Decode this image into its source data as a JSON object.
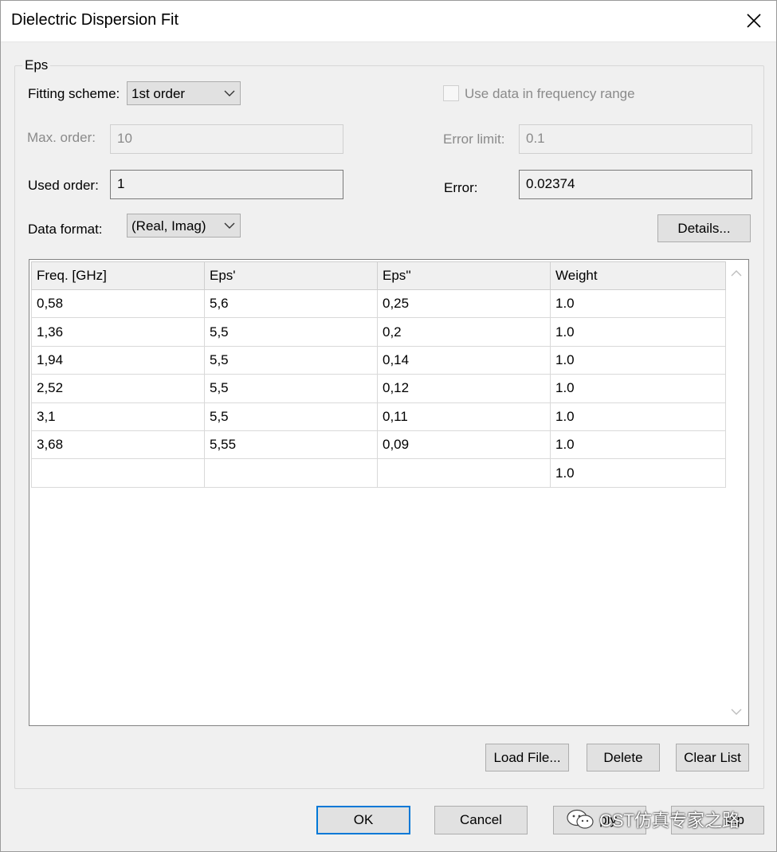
{
  "window": {
    "title": "Dielectric Dispersion Fit"
  },
  "group": {
    "label": "Eps"
  },
  "fitting_scheme": {
    "label": "Fitting scheme:",
    "value": "1st order"
  },
  "use_range": {
    "label": "Use data in frequency range",
    "checked": false
  },
  "max_order": {
    "label": "Max. order:",
    "value": "10"
  },
  "error_limit": {
    "label": "Error limit:",
    "value": "0.1"
  },
  "used_order": {
    "label": "Used order:",
    "value": "1"
  },
  "error": {
    "label": "Error:",
    "value": "0.02374"
  },
  "data_format": {
    "label": "Data format:",
    "value": "(Real, Imag)"
  },
  "buttons": {
    "details": "Details...",
    "load_file": "Load File...",
    "delete": "Delete",
    "clear_list": "Clear List",
    "ok": "OK",
    "cancel": "Cancel",
    "apply_partial": "ply",
    "help_partial": "elp"
  },
  "table": {
    "columns": [
      "Freq. [GHz]",
      "Eps'",
      "Eps''",
      "Weight"
    ],
    "rows": [
      [
        "0,58",
        "5,6",
        "0,25",
        "1.0"
      ],
      [
        "1,36",
        "5,5",
        "0,2",
        "1.0"
      ],
      [
        "1,94",
        "5,5",
        "0,14",
        "1.0"
      ],
      [
        "2,52",
        "5,5",
        "0,12",
        "1.0"
      ],
      [
        "3,1",
        "5,5",
        "0,11",
        "1.0"
      ],
      [
        "3,68",
        "5,55",
        "0,09",
        "1.0"
      ],
      [
        "",
        "",
        "",
        "1.0"
      ]
    ]
  },
  "watermark": {
    "text": "CST仿真专家之路",
    "icon": "wechat-icon"
  },
  "colors": {
    "focus_border": "#0078d7",
    "button_bg": "#e1e1e1",
    "dialog_bg": "#f0f0f0"
  }
}
